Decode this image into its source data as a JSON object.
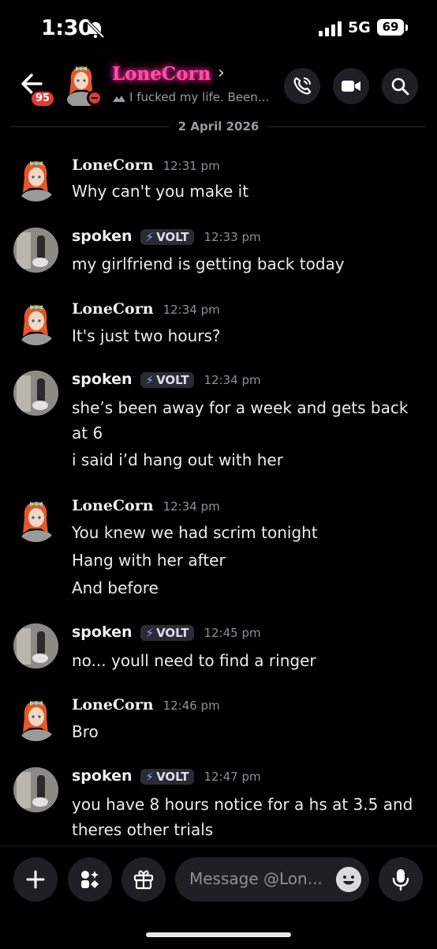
{
  "status_bar": {
    "time": "1:30",
    "network": "5G",
    "battery": "69"
  },
  "header": {
    "unread_badge": "95",
    "contact_name": "LoneCorn",
    "chevron": "›",
    "status_text": "I fucked my life. Been..."
  },
  "date_divider": "2 April 2026",
  "messages": [
    {
      "author": "LoneCorn",
      "time": "12:31 pm",
      "lines": [
        "Why can't you make it"
      ]
    },
    {
      "author": "spoken",
      "badge": "VOLT",
      "time": "12:33 pm",
      "lines": [
        "my girlfriend is getting back today"
      ]
    },
    {
      "author": "LoneCorn",
      "time": "12:34 pm",
      "lines": [
        "It's just two hours?"
      ]
    },
    {
      "author": "spoken",
      "badge": "VOLT",
      "time": "12:34 pm",
      "lines": [
        "she’s been away for a week and gets back",
        "at 6",
        "i said i’d hang out with her"
      ]
    },
    {
      "author": "LoneCorn",
      "time": "12:34 pm",
      "lines": [
        "You knew we had scrim tonight",
        "Hang with her after",
        "And before"
      ]
    },
    {
      "author": "spoken",
      "badge": "VOLT",
      "time": "12:45 pm",
      "lines": [
        "no... youll need to find a ringer"
      ]
    },
    {
      "author": "LoneCorn",
      "time": "12:46 pm",
      "lines": [
        "Bro"
      ]
    },
    {
      "author": "spoken",
      "badge": "VOLT",
      "time": "12:47 pm",
      "lines": [
        "you have 8 hours notice for a hs at 3.5 and",
        "theres other trials"
      ]
    }
  ],
  "composer": {
    "placeholder": "Message @Lon..."
  },
  "colors": {
    "background": "#000000",
    "name_glow": "#ff4fa8",
    "badge_red": "#e53935",
    "button_bg": "#1f2025",
    "bolt": "#8fa0ff"
  },
  "icons": [
    "back-arrow-icon",
    "voice-call-icon",
    "video-call-icon",
    "search-icon",
    "plus-icon",
    "apps-icon",
    "gift-icon",
    "emoji-icon",
    "microphone-icon"
  ]
}
